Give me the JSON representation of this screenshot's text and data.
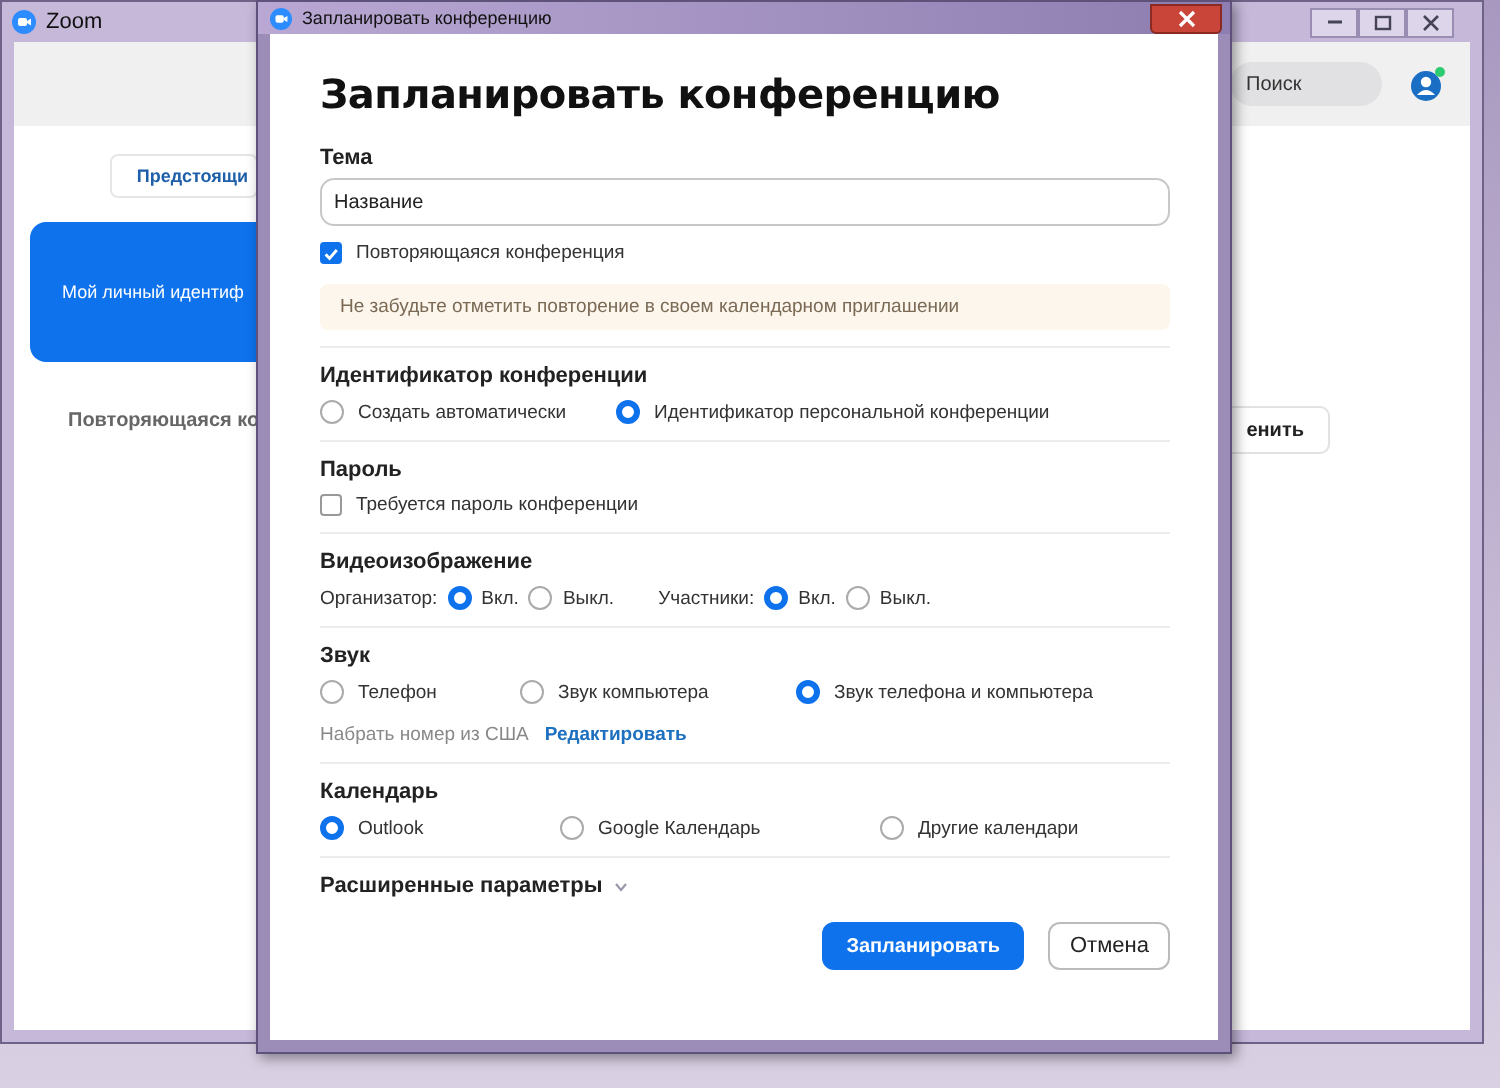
{
  "main_window": {
    "title": "Zoom",
    "search": {
      "placeholder": "Поиск"
    },
    "tab": "Предстоящи",
    "card_text": "Мой личный идентиф",
    "recurring_label": "Повторяющаяся ко",
    "side_button": "енить"
  },
  "dialog": {
    "title": "Запланировать конференцию",
    "heading": "Запланировать конференцию",
    "topic": {
      "label": "Тема",
      "value": "Название"
    },
    "recurring": {
      "label": "Повторяющаяся конференция",
      "checked": true
    },
    "notice": "Не забудьте отметить повторение в своем календарном приглашении",
    "meeting_id": {
      "label": "Идентификатор конференции",
      "options": [
        {
          "label": "Создать автоматически",
          "selected": false
        },
        {
          "label": "Идентификатор персональной конференции",
          "selected": true
        }
      ]
    },
    "password": {
      "label": "Пароль",
      "checkbox": {
        "label": "Требуется пароль конференции",
        "checked": false
      }
    },
    "video": {
      "label": "Видеоизображение",
      "groups": [
        {
          "label": "Организатор:",
          "options": [
            {
              "label": "Вкл.",
              "selected": true
            },
            {
              "label": "Выкл.",
              "selected": false
            }
          ]
        },
        {
          "label": "Участники:",
          "options": [
            {
              "label": "Вкл.",
              "selected": true
            },
            {
              "label": "Выкл.",
              "selected": false
            }
          ]
        }
      ]
    },
    "audio": {
      "label": "Звук",
      "options": [
        {
          "label": "Телефон",
          "selected": false
        },
        {
          "label": "Звук компьютера",
          "selected": false
        },
        {
          "label": "Звук телефона и компьютера",
          "selected": true
        }
      ],
      "dial_text": "Набрать номер из США",
      "dial_link": "Редактировать"
    },
    "calendar": {
      "label": "Календарь",
      "options": [
        {
          "label": "Outlook",
          "selected": true
        },
        {
          "label": "Google Календарь",
          "selected": false
        },
        {
          "label": "Другие календари",
          "selected": false
        }
      ]
    },
    "advanced": "Расширенные параметры",
    "buttons": [
      {
        "label": "Запланировать",
        "kind": "primary"
      },
      {
        "label": "Отмена",
        "kind": "secondary"
      }
    ]
  }
}
